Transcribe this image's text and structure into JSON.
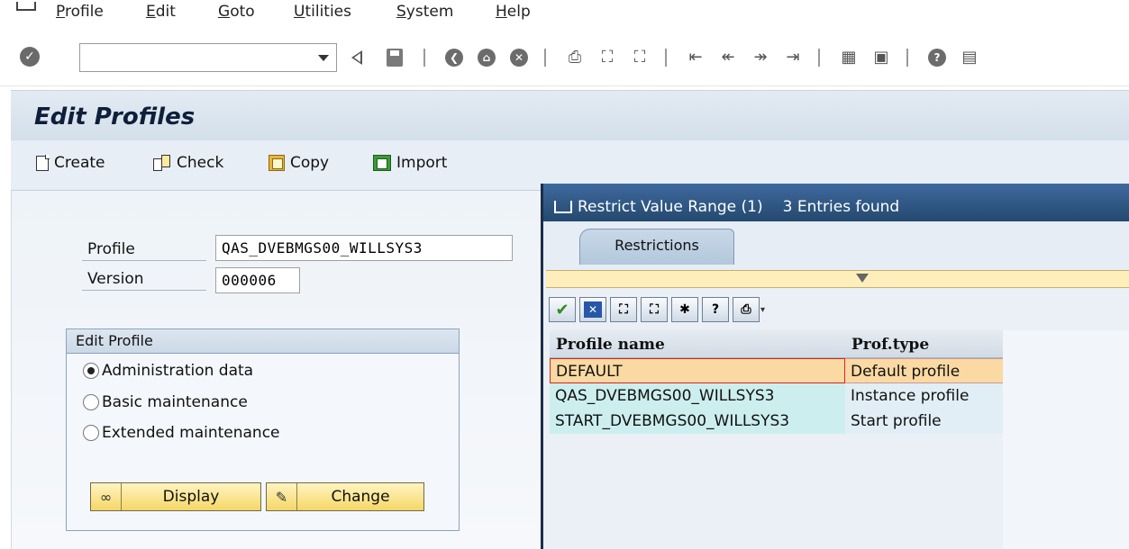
{
  "menubar": {
    "items": [
      {
        "label": "Profile",
        "mnemonic": "P",
        "rest": "rofile"
      },
      {
        "label": "Edit",
        "mnemonic": "E",
        "rest": "dit"
      },
      {
        "label": "Goto",
        "mnemonic": "G",
        "rest": "oto"
      },
      {
        "label": "Utilities",
        "mnemonic": "U",
        "rest": "tilities"
      },
      {
        "label": "System",
        "mnemonic": "S",
        "rest": "ystem"
      },
      {
        "label": "Help",
        "mnemonic": "H",
        "rest": "elp"
      }
    ]
  },
  "toolbar": {
    "command_field_value": "",
    "icons": [
      "enter-icon",
      "back-icon",
      "save-icon",
      "back-green-icon",
      "exit-icon",
      "cancel-icon",
      "print-icon",
      "find-icon",
      "find-next-icon",
      "first-page-icon",
      "previous-page-icon",
      "next-page-icon",
      "last-page-icon",
      "create-session-icon",
      "shortcut-icon",
      "help-icon",
      "layout-menu-icon"
    ]
  },
  "screen": {
    "title": "Edit Profiles",
    "app_toolbar": {
      "create": "Create",
      "check": "Check",
      "copy": "Copy",
      "import": "Import"
    }
  },
  "form": {
    "profile_label": "Profile",
    "profile_value": "QAS_DVEBMGS00_WILLSYS3",
    "version_label": "Version",
    "version_value": "000006"
  },
  "edit_profile": {
    "title": "Edit Profile",
    "options": [
      {
        "label": "Administration data",
        "selected": true
      },
      {
        "label": "Basic maintenance",
        "selected": false
      },
      {
        "label": "Extended maintenance",
        "selected": false
      }
    ],
    "display_button": "Display",
    "change_button": "Change"
  },
  "dialog": {
    "title": "Restrict Value Range (1)",
    "entries_found": "3 Entries found",
    "tab_label": "Restrictions",
    "columns": [
      "Profile name",
      "Prof.type"
    ],
    "rows": [
      {
        "name": "DEFAULT",
        "type": "Default profile",
        "selected": true
      },
      {
        "name": "QAS_DVEBMGS00_WILLSYS3",
        "type": "Instance profile",
        "selected": false
      },
      {
        "name": "START_DVEBMGS00_WILLSYS3",
        "type": "Start profile",
        "selected": false
      }
    ]
  },
  "colors": {
    "title_bar_blue": "#24496f",
    "selected_row": "#fbd9a3",
    "button_yellow": "#f5d766",
    "row_cyan": "#cdeeee"
  }
}
